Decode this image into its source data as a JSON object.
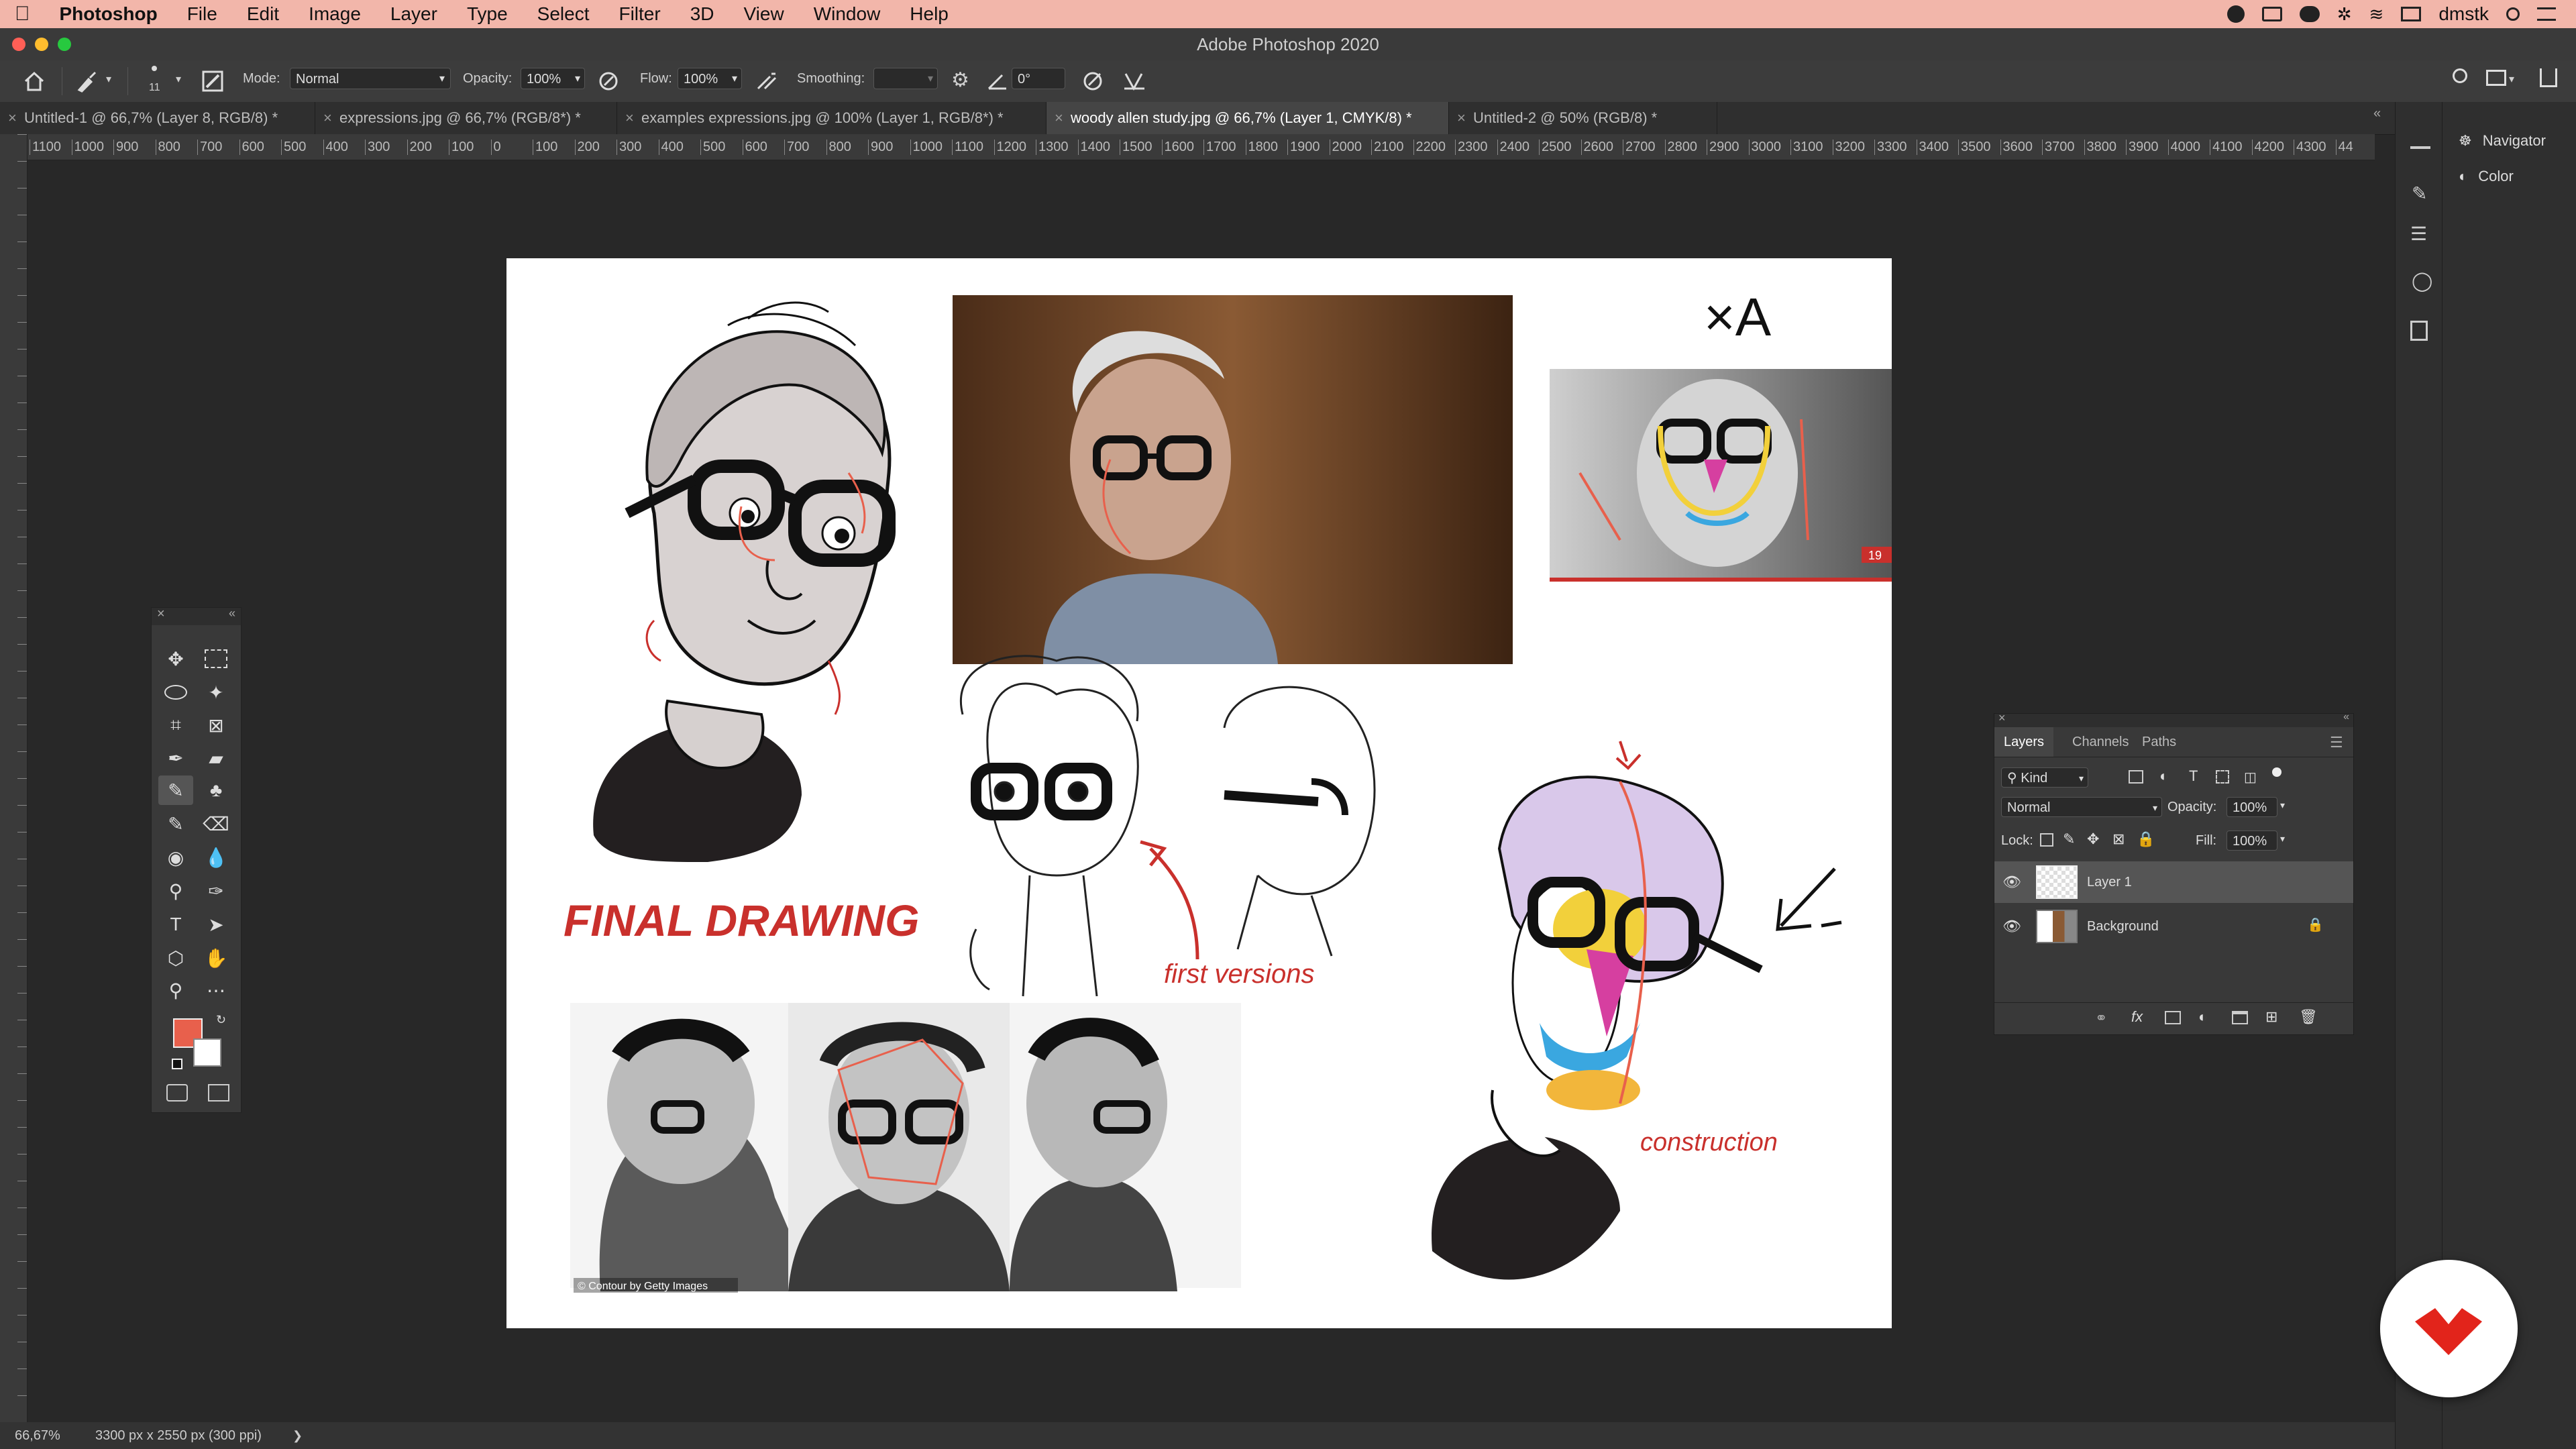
{
  "menubar": {
    "apple_icon": "apple-icon",
    "items": [
      "Photoshop",
      "File",
      "Edit",
      "Image",
      "Layer",
      "Type",
      "Select",
      "Filter",
      "3D",
      "View",
      "Window",
      "Help"
    ],
    "user": "dmstk"
  },
  "window": {
    "title": "Adobe Photoshop 2020"
  },
  "options": {
    "brush_size": "11",
    "mode_label": "Mode:",
    "mode_value": "Normal",
    "opacity_label": "Opacity:",
    "opacity_value": "100%",
    "flow_label": "Flow:",
    "flow_value": "100%",
    "smoothing_label": "Smoothing:",
    "smoothing_value": "",
    "angle_value": "0°"
  },
  "tabs": [
    {
      "label": "Untitled-1 @ 66,7% (Layer 8, RGB/8) *",
      "active": false
    },
    {
      "label": "expressions.jpg @ 66,7% (RGB/8*) *",
      "active": false
    },
    {
      "label": "examples expressions.jpg @ 100% (Layer 1, RGB/8*) *",
      "active": false
    },
    {
      "label": "woody allen study.jpg @ 66,7% (Layer 1, CMYK/8) *",
      "active": true
    },
    {
      "label": "Untitled-2 @ 50% (RGB/8) *",
      "active": false
    }
  ],
  "ruler": {
    "h_ticks": [
      "1100",
      "1000",
      "900",
      "800",
      "700",
      "600",
      "500",
      "400",
      "300",
      "200",
      "100",
      "0",
      "100",
      "200",
      "300",
      "400",
      "500",
      "600",
      "700",
      "800",
      "900",
      "1000",
      "1100",
      "1200",
      "1300",
      "1400",
      "1500",
      "1600",
      "1700",
      "1800",
      "1900",
      "2000",
      "2100",
      "2200",
      "2300",
      "2400",
      "2500",
      "2600",
      "2700",
      "2800",
      "2900",
      "3000",
      "3100",
      "3200",
      "3300",
      "3400",
      "3500",
      "3600",
      "3700",
      "3800",
      "3900",
      "4000",
      "4100",
      "4200",
      "4300",
      "44"
    ]
  },
  "canvas": {
    "label_final": "FINAL DRAWING",
    "label_first": "first versions",
    "label_construction": "construction",
    "initials": "×A",
    "photo_credit": "© Contour by Getty Images",
    "red_tag": "19"
  },
  "dock": {
    "navigator_label": "Navigator",
    "color_label": "Color"
  },
  "layers_panel": {
    "tabs": [
      "Layers",
      "Channels",
      "Paths"
    ],
    "filter_kind": "Kind",
    "blend_mode": "Normal",
    "opacity_label": "Opacity:",
    "opacity_value": "100%",
    "lock_label": "Lock:",
    "fill_label": "Fill:",
    "fill_value": "100%",
    "layers": [
      {
        "name": "Layer 1",
        "selected": true
      },
      {
        "name": "Background",
        "selected": false
      }
    ]
  },
  "status": {
    "zoom": "66,67%",
    "doc_info": "3300 px x 2550 px (300 ppi)"
  },
  "colors": {
    "foreground": "#e8604c",
    "background": "#ffffff",
    "accent_red": "#c9302c"
  }
}
